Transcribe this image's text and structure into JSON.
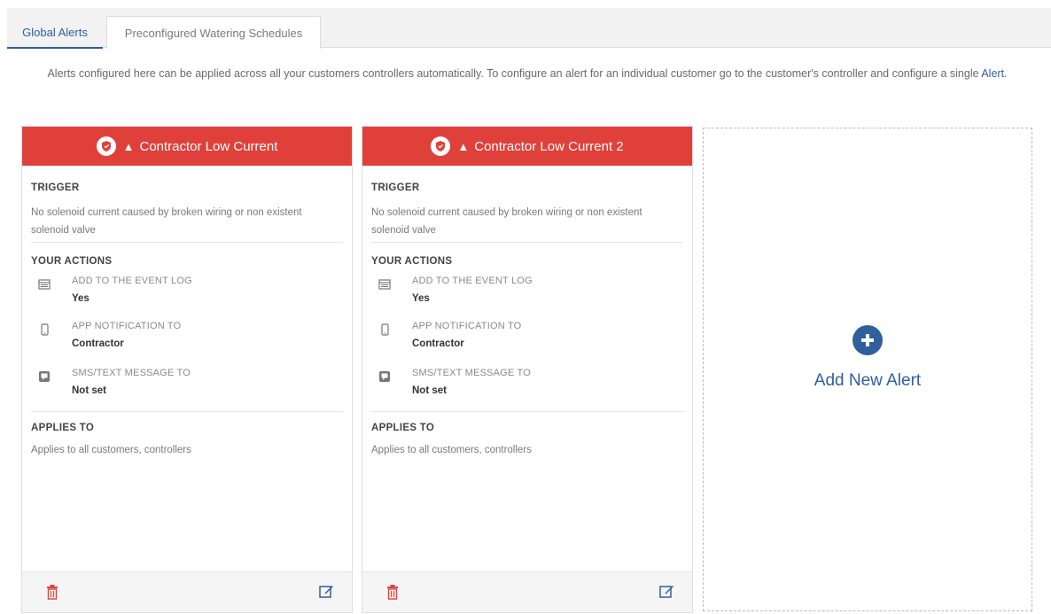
{
  "tabs": [
    {
      "label": "Global Alerts",
      "active": true
    },
    {
      "label": "Preconfigured Watering Schedules",
      "active": false
    }
  ],
  "intro": {
    "text_before_link": "Alerts configured here can be applied across all your customers controllers automatically. To configure an alert for an individual customer go to the customer's controller and configure a single ",
    "link": "Alert",
    "text_after_link": "."
  },
  "colors": {
    "accent": "#2f5f9e",
    "alert_header": "#e0403a",
    "danger_icon": "#e0403a"
  },
  "cards": [
    {
      "title": "Contractor Low Current",
      "trigger_title": "TRIGGER",
      "trigger_text": "No solenoid current caused by broken wiring or non existent solenoid valve",
      "actions_title": "YOUR ACTIONS",
      "actions": [
        {
          "icon": "event-log-icon",
          "label": "ADD TO THE EVENT LOG",
          "value": "Yes"
        },
        {
          "icon": "phone-icon",
          "label": "APP NOTIFICATION TO",
          "value": "Contractor"
        },
        {
          "icon": "sms-icon",
          "label": "SMS/TEXT MESSAGE TO",
          "value": "Not set"
        }
      ],
      "applies_title": "APPLIES TO",
      "applies_text": "Applies to all customers, controllers"
    },
    {
      "title": "Contractor Low Current 2",
      "trigger_title": "TRIGGER",
      "trigger_text": "No solenoid current caused by broken wiring or non existent solenoid valve",
      "actions_title": "YOUR ACTIONS",
      "actions": [
        {
          "icon": "event-log-icon",
          "label": "ADD TO THE EVENT LOG",
          "value": "Yes"
        },
        {
          "icon": "phone-icon",
          "label": "APP NOTIFICATION TO",
          "value": "Contractor"
        },
        {
          "icon": "sms-icon",
          "label": "SMS/TEXT MESSAGE TO",
          "value": "Not set"
        }
      ],
      "applies_title": "APPLIES TO",
      "applies_text": "Applies to all customers, controllers"
    }
  ],
  "add_alert": {
    "label": "Add New Alert",
    "icon": "plus-circle-icon"
  }
}
